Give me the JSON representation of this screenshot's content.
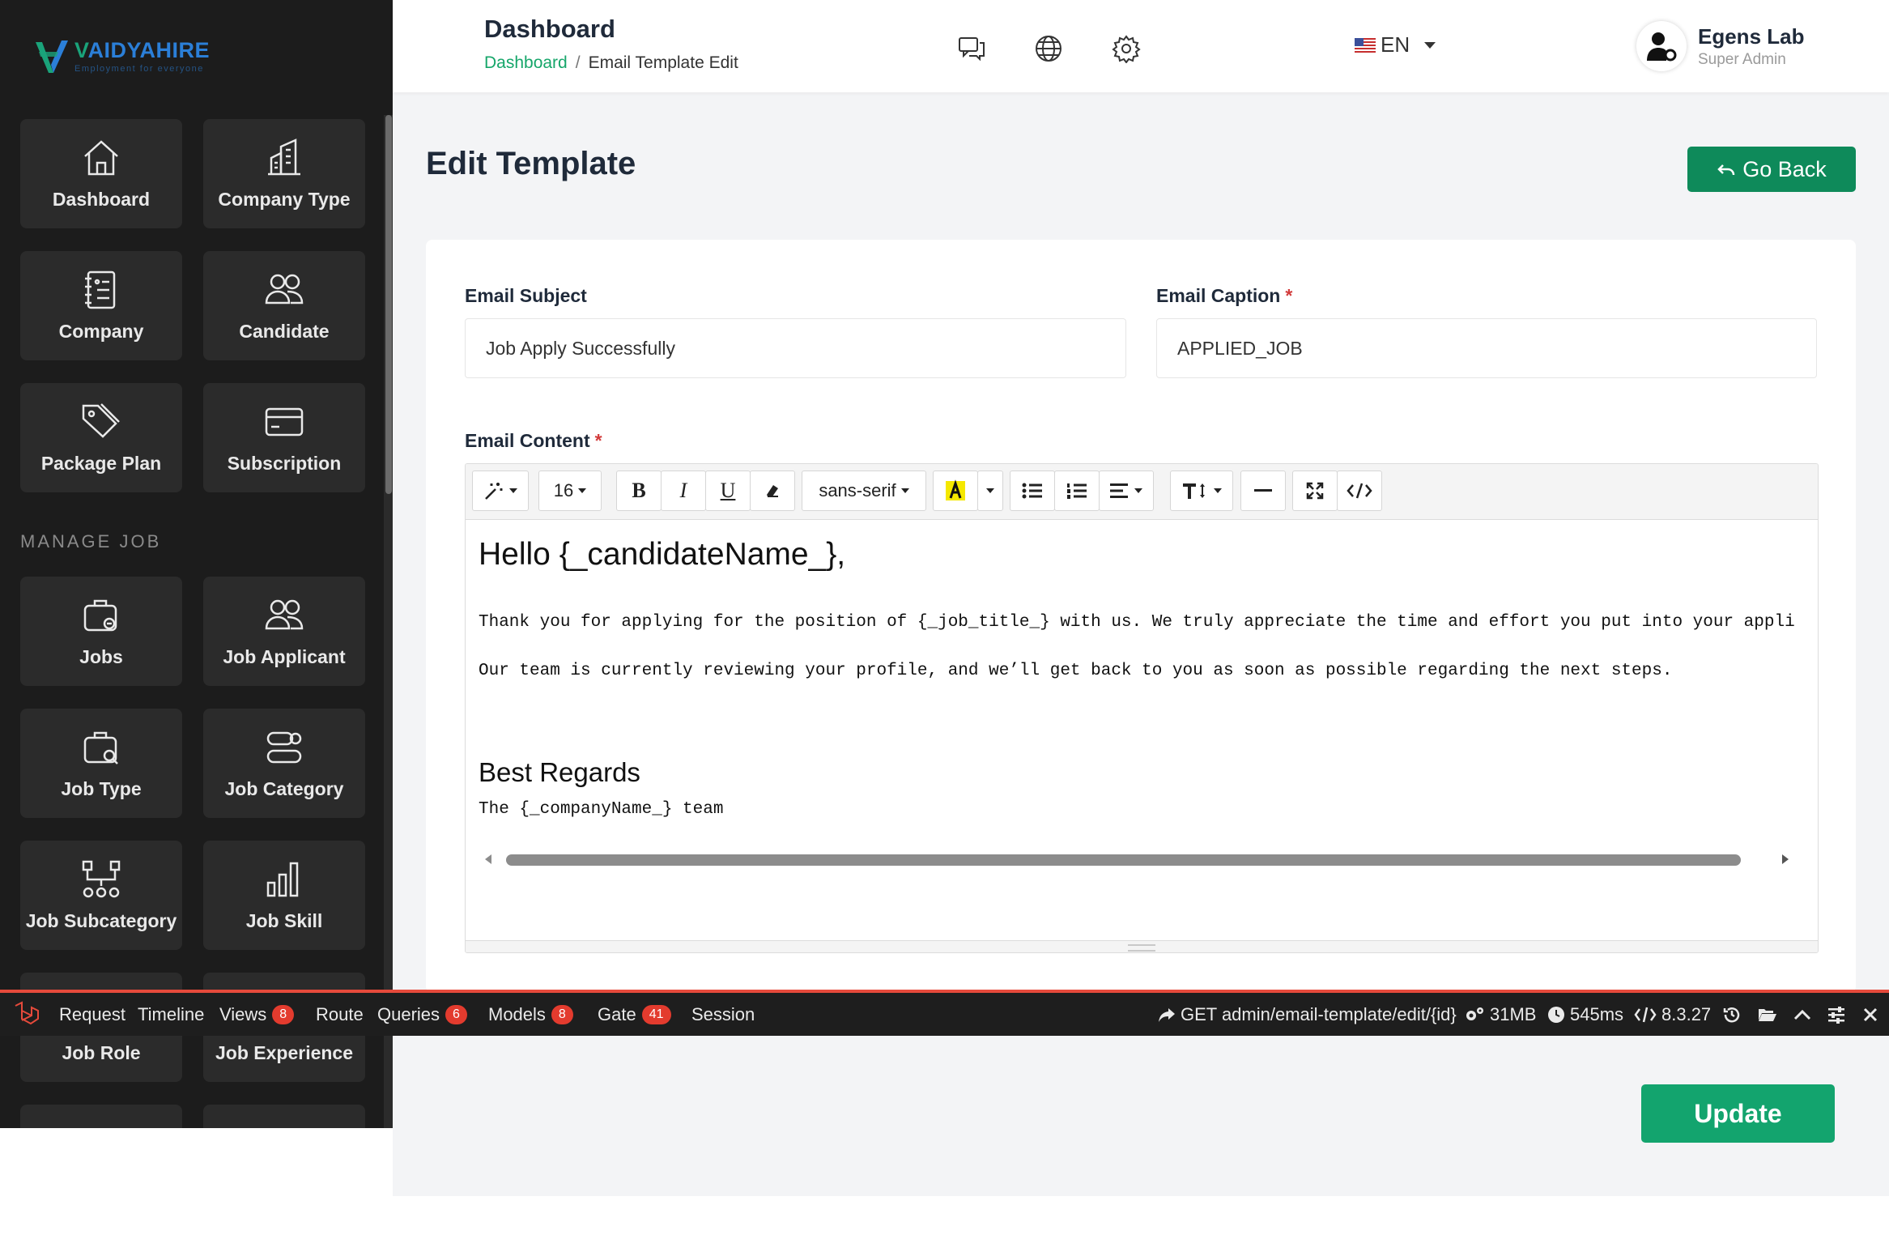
{
  "brand": {
    "letter": "V",
    "name_rest": "AIDYAHIRE",
    "tagline": "Employment for everyone",
    "colors": {
      "green": "#1aa37a",
      "blue": "#2b7fd8"
    }
  },
  "sidebar": {
    "tiles": [
      {
        "label": "Dashboard",
        "icon": "home-icon"
      },
      {
        "label": "Company Type",
        "icon": "buildings-icon"
      },
      {
        "label": "Company",
        "icon": "address-book-icon"
      },
      {
        "label": "Candidate",
        "icon": "users-icon"
      },
      {
        "label": "Package Plan",
        "icon": "tags-icon"
      },
      {
        "label": "Subscription",
        "icon": "credit-card-icon"
      }
    ],
    "section_label": "MANAGE JOB",
    "job_tiles": [
      {
        "label": "Jobs",
        "icon": "briefcase-icon"
      },
      {
        "label": "Job Applicant",
        "icon": "users-icon"
      },
      {
        "label": "Job Type",
        "icon": "briefcase-search-icon"
      },
      {
        "label": "Job Category",
        "icon": "category-icon"
      },
      {
        "label": "Job Subcategory",
        "icon": "hierarchy-icon"
      },
      {
        "label": "Job Skill",
        "icon": "bar-chart-icon"
      },
      {
        "label": "Job Role",
        "icon": "role-icon"
      },
      {
        "label": "Job Experience",
        "icon": "experience-icon"
      }
    ]
  },
  "header": {
    "title": "Dashboard",
    "breadcrumb": {
      "home": "Dashboard",
      "separator": "/",
      "current": "Email Template Edit"
    },
    "icons": [
      "chat-icon",
      "globe-icon",
      "gear-icon"
    ],
    "language": "EN",
    "user": {
      "name": "Egens Lab",
      "role": "Super Admin"
    }
  },
  "page": {
    "title": "Edit Template",
    "go_back": "Go Back",
    "update": "Update"
  },
  "form": {
    "subject": {
      "label": "Email Subject",
      "value": "Job Apply Successfully"
    },
    "caption": {
      "label": "Email Caption",
      "required_mark": "*",
      "value": "APPLIED_JOB"
    },
    "content": {
      "label": "Email Content",
      "required_mark": "*"
    }
  },
  "editor": {
    "toolbar": {
      "font_size": "16",
      "font_family": "sans-serif"
    },
    "body": {
      "greeting": "Hello {_candidateName_},",
      "line1": "Thank you for applying for the position of {_job_title_} with us. We truly appreciate the time and effort you put into your application.",
      "line2": "Our team is currently reviewing your profile, and we’ll get back to you as soon as possible regarding the next steps.",
      "regards": "Best Regards",
      "signature": "The {_companyName_} team"
    }
  },
  "debugbar": {
    "tabs": [
      {
        "label": "Request"
      },
      {
        "label": "Timeline"
      },
      {
        "label": "Views",
        "badge": "8"
      },
      {
        "label": "Route"
      },
      {
        "label": "Queries",
        "badge": "6"
      },
      {
        "label": "Models",
        "badge": "8"
      },
      {
        "label": "Gate",
        "badge": "41"
      },
      {
        "label": "Session"
      }
    ],
    "route": "GET admin/email-template/edit/{id}",
    "memory": "31MB",
    "time": "545ms",
    "version": "8.3.27",
    "accent": "#e64a3b"
  }
}
